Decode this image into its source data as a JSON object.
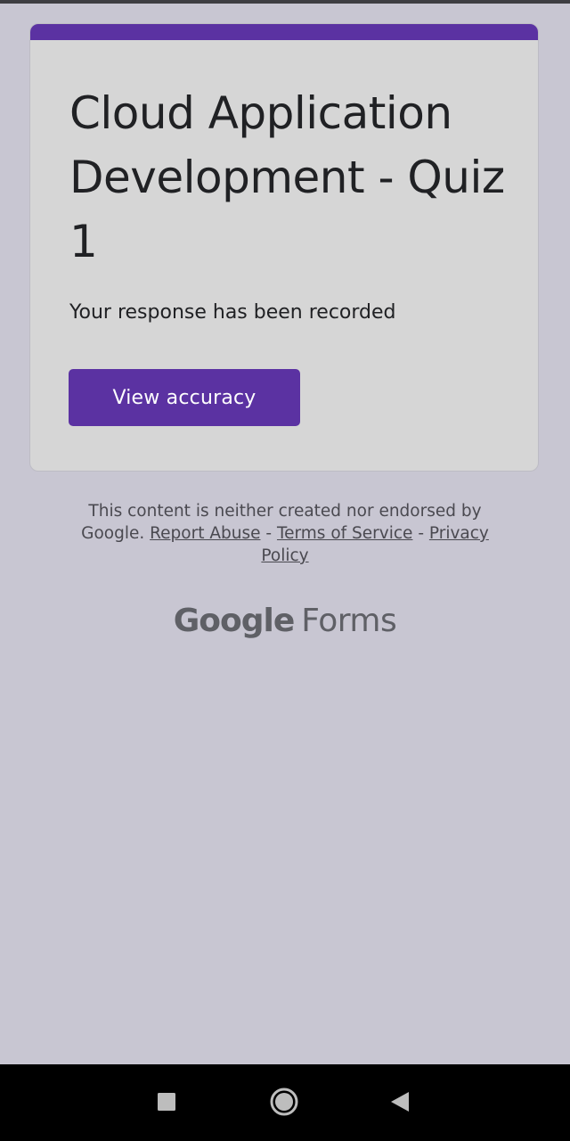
{
  "form": {
    "title": "Cloud Application Development - Quiz 1",
    "confirmation_message": "Your response has been recorded",
    "view_button_label": "View accuracy",
    "accent_color": "#5b32a2"
  },
  "footer": {
    "disclaimer_text": "This content is neither created nor endorsed by Google.",
    "separator": "-",
    "links": {
      "report_abuse": "Report Abuse",
      "terms": "Terms of Service",
      "privacy": "Privacy Policy"
    }
  },
  "logo": {
    "brand": "Google",
    "product": "Forms"
  },
  "android_nav": {
    "icons": [
      "recents-icon",
      "home-icon",
      "back-icon"
    ]
  }
}
